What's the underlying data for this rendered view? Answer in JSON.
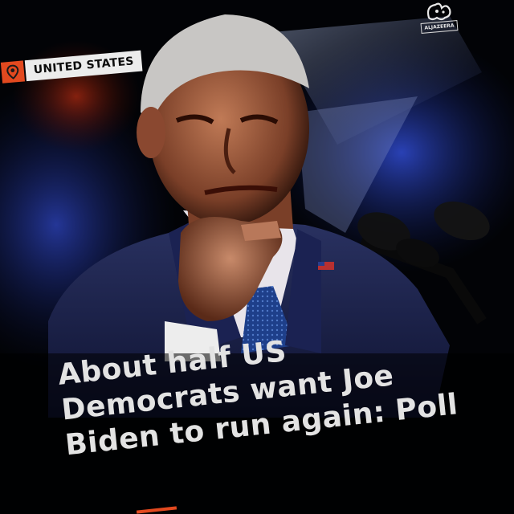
{
  "tag": {
    "label": "UNITED STATES",
    "icon": "location-pin-icon",
    "color": "#e2491f"
  },
  "logo": {
    "brand": "ALJAZEERA",
    "icon": "aljazeera-calligraphy-icon"
  },
  "headline": {
    "lines": [
      "About half US",
      "Democrats want Joe",
      "Biden to run again: Poll"
    ]
  },
  "colors": {
    "background": "#020306",
    "accent": "#e2491f",
    "headline_text": "#e3e3e3",
    "suit": "#1a2147"
  }
}
